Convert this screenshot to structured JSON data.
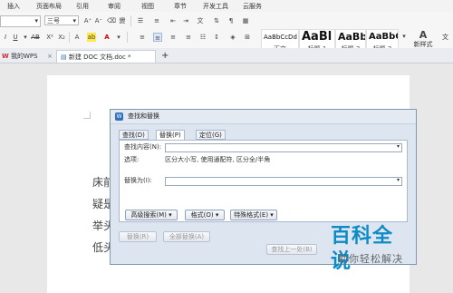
{
  "ribbon": {
    "tabs": [
      "插入",
      "页面布局",
      "引用",
      "审阅",
      "视图",
      "章节",
      "开发工具",
      "云服务"
    ],
    "font_name": "",
    "font_size": "三号",
    "styles": [
      {
        "sample": "AaBbCcDd",
        "label": "正文"
      },
      {
        "sample": "AaBl",
        "label": "标题 1"
      },
      {
        "sample": "AaBb(",
        "label": "标题 2"
      },
      {
        "sample": "AaBbC",
        "label": "标题 3"
      }
    ],
    "new_style": "新样式",
    "text_tool": "文"
  },
  "doc_tabs": {
    "tab1": "我的WPS",
    "tab2": "新建 DOC 文档.doc *",
    "new_tab": "+"
  },
  "document": {
    "lines": [
      "床前",
      "疑是",
      "举头",
      "低头"
    ]
  },
  "dialog": {
    "title": "查找和替换",
    "tabs": [
      "查找(D)",
      "替换(P)",
      "定位(G)"
    ],
    "find_label": "查找内容(N):",
    "options_label": "选项:",
    "options_value": "区分大小写, 使用通配符, 区分全/半角",
    "replace_label": "替换为(I):",
    "advanced_search": "高级搜索(M) ▾",
    "format": "格式(O) ▾",
    "special_format": "特殊格式(E) ▾",
    "replace_button": "替换(R)",
    "replace_all_button": "全部替换(A)",
    "find_prev_button": "查找上一处(B)"
  },
  "watermark": {
    "logo": "百科全说",
    "tagline": "助你轻松解决"
  }
}
